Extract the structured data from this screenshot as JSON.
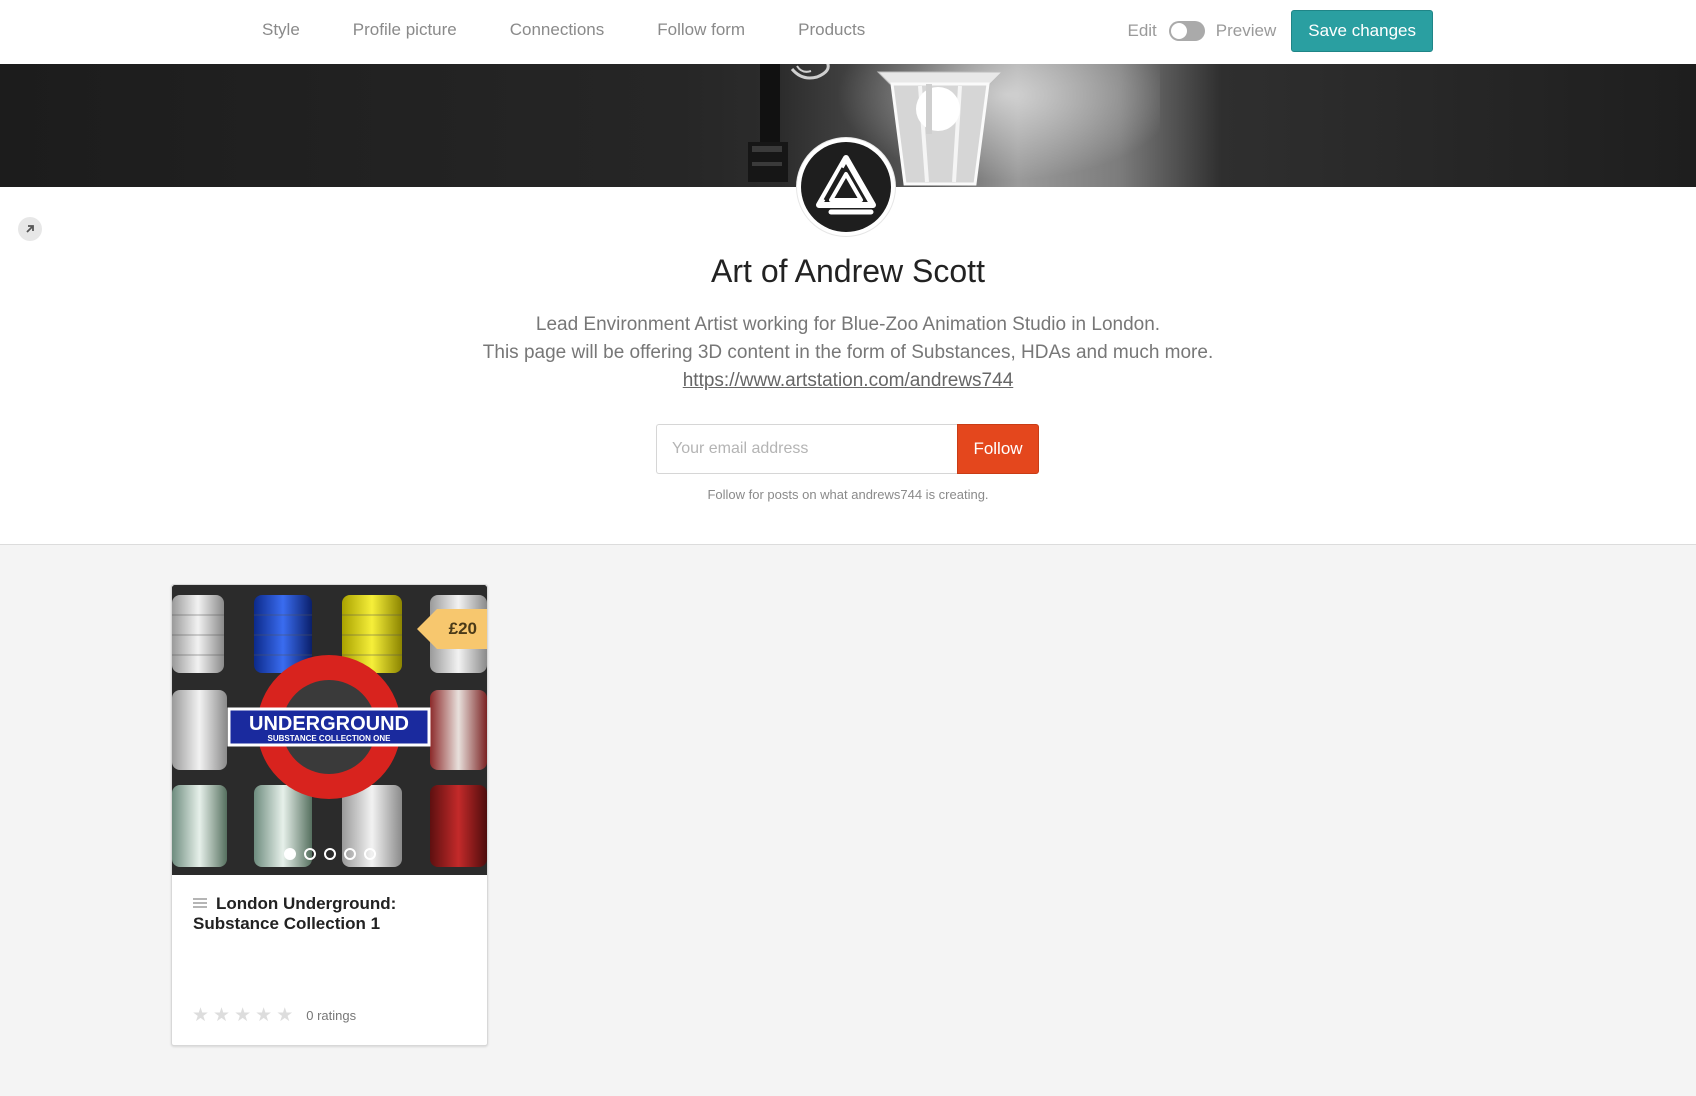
{
  "nav": {
    "items": [
      {
        "label": "Style"
      },
      {
        "label": "Profile picture"
      },
      {
        "label": "Connections"
      },
      {
        "label": "Follow form"
      },
      {
        "label": "Products"
      }
    ],
    "edit_label": "Edit",
    "preview_label": "Preview",
    "toggle_state": "edit",
    "save_label": "Save changes"
  },
  "profile": {
    "title": "Art of Andrew Scott",
    "bio_line1": "Lead Environment Artist working for Blue-Zoo Animation Studio in London.",
    "bio_line2": "This page will be offering 3D content in the form of Substances, HDAs and much more.",
    "link": "https://www.artstation.com/andrews744",
    "email_placeholder": "Your email address",
    "follow_label": "Follow",
    "follow_note": "Follow for posts on what andrews744 is creating."
  },
  "products": [
    {
      "title": "London Underground: Substance Collection 1",
      "price": "£20",
      "image_text": "UNDERGROUND",
      "image_subtext": "SUBSTANCE COLLECTION ONE",
      "slides": 5,
      "active_slide": 1,
      "rating_stars": 0,
      "ratings_label": "0 ratings"
    }
  ],
  "colors": {
    "accent": "#2a9fa1",
    "follow": "#e4471d",
    "price": "#f7c76e"
  },
  "icons": {
    "expand": "expand-arrow-icon",
    "drag": "drag-handle-icon",
    "star": "star-icon"
  }
}
